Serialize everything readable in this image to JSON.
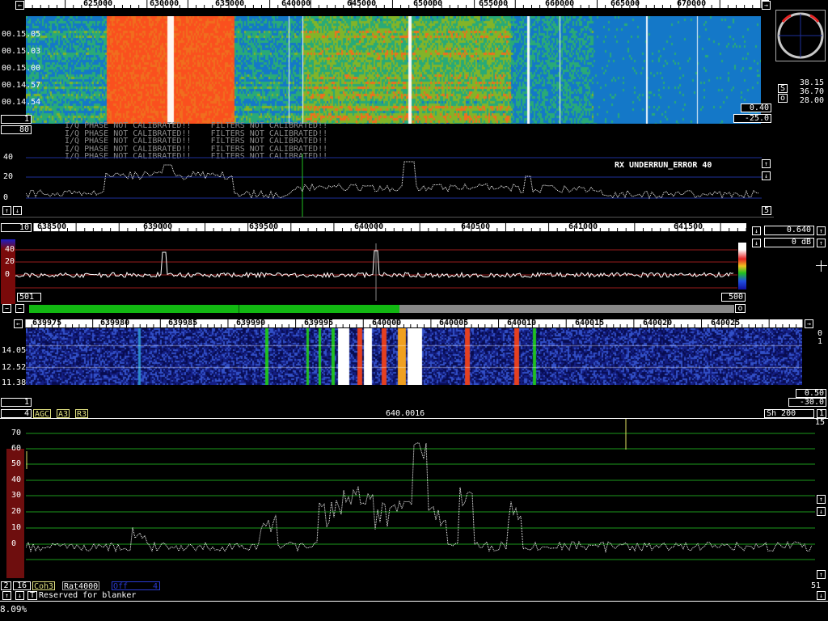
{
  "colors": {
    "grid_blue": "#1e2f9a",
    "grid_green": "#1c9a1c",
    "grid_red": "#9a1c1c",
    "trace": "#ffffff",
    "progress_green": "#12b812",
    "bar_red": "#6e0e0e"
  },
  "wide_waterfall": {
    "frequency_labels": [
      "625000",
      "630000",
      "635000",
      "640000",
      "645000",
      "650000",
      "655000",
      "660000",
      "665000",
      "670000"
    ],
    "time_labels": [
      "00.15.05",
      "00.15.03",
      "00.15.00",
      "00.14.57",
      "00.14.54"
    ],
    "gain_value": "0.40",
    "offset_value": "-25.0",
    "left_button": "1"
  },
  "polar_scope": {
    "s_label": "S",
    "o_label": "o",
    "values": [
      "38.15",
      "36.70",
      "28.00"
    ]
  },
  "wide_spectrum": {
    "avg_value": "80",
    "warning_lines": [
      "I/Q PHASE NOT CALIBRATED!!    FILTERS NOT CALIBRATED!!",
      "I/Q PHASE NOT CALIBRATED!!    FILTERS NOT CALIBRATED!!",
      "I/Q PHASE NOT CALIBRATED!!    FILTERS NOT CALIBRATED!!",
      "I/Q PHASE NOT CALIBRATED!!    FILTERS NOT CALIBRATED!!",
      "I/Q PHASE NOT CALIBRATED!!    FILTERS NOT CALIBRATED!!"
    ],
    "y_labels": [
      "40",
      "20",
      "0"
    ],
    "error_text": "RX UNDERRUN_ERROR 40",
    "right_value": "5"
  },
  "baseband": {
    "left_value": "10",
    "frequency_labels": [
      "638500",
      "639000",
      "639500",
      "640000",
      "640500",
      "641000",
      "641500"
    ],
    "y_labels": [
      "40",
      "20",
      "0"
    ],
    "left_count": "501",
    "right_count": "500",
    "gain_value": "0.640",
    "db_value": "0 dB",
    "progress_fraction": 0.525,
    "progress_marker_fraction": 0.297,
    "end_button": "o"
  },
  "narrow_waterfall": {
    "frequency_labels": [
      "639975",
      "639980",
      "639985",
      "639990",
      "639995",
      "640000",
      "640005",
      "640010",
      "640015",
      "640020",
      "640025"
    ],
    "time_labels": [
      "14.05",
      "12.52",
      "11.38"
    ],
    "right_top": "0",
    "right_second": "1",
    "gain_value": "0.50",
    "offset_value": "-30.0",
    "left_button": "1"
  },
  "hires_spectrum": {
    "left_value": "4",
    "agc": "AGC",
    "a3": "A3",
    "r3": "R3",
    "center_frequency": "640.0016",
    "shift": "Sh 200",
    "right_value": "1",
    "right_top": "15",
    "y_labels": [
      "70",
      "60",
      "50",
      "40",
      "30",
      "20",
      "10",
      "0"
    ],
    "bottom_left_value": "2",
    "bottom_second": "16",
    "coh": "Coh3",
    "rat": "Rat4000",
    "off_label": "Off",
    "off_value": "4",
    "t_label": "T",
    "blanker_text": "Reserved for blanker",
    "right_bottom": "51"
  },
  "status": {
    "cpu_load": "8.09%"
  }
}
